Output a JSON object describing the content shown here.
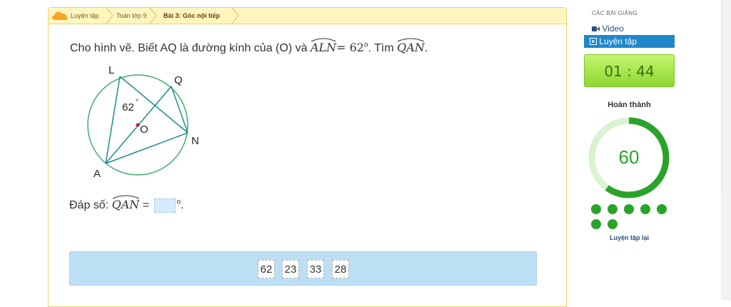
{
  "breadcrumb": {
    "items": [
      "Luyện tập",
      "Toán lớp 9",
      "Bài 3: Góc nội tiếp"
    ]
  },
  "question": {
    "prefix": "Cho hình vẽ. Biết AQ là đường kính của (O) và ",
    "given_angle": "ALN",
    "equals": " = 62",
    "degree": "o",
    "middle": ". Tìm ",
    "find_angle": "QAN",
    "suffix": "."
  },
  "figure": {
    "labels": {
      "L": "L",
      "Q": "Q",
      "N": "N",
      "A": "A",
      "O": "O"
    },
    "angle_text": "62",
    "angle_degree": "°"
  },
  "answer": {
    "prefix": "Đáp số: ",
    "angle": "QAN",
    "equals": " = ",
    "unit": "o",
    "suffix": "."
  },
  "choices": [
    "62",
    "23",
    "33",
    "28"
  ],
  "sidebar": {
    "heading": "CÁC BÀI GIẢNG",
    "video_label": "Video",
    "practice_label": "Luyện tập",
    "timer": "01 : 44",
    "progress_label": "Hoàn thành",
    "progress_value": "60",
    "progress_fraction": 0.6,
    "retry_label": "Luyện tập lại"
  },
  "colors": {
    "accent_blue": "#1e88c9",
    "progress_green": "#2aa32a",
    "breadcrumb_bg": "#fff6bf",
    "choices_bg": "#bddff3"
  }
}
